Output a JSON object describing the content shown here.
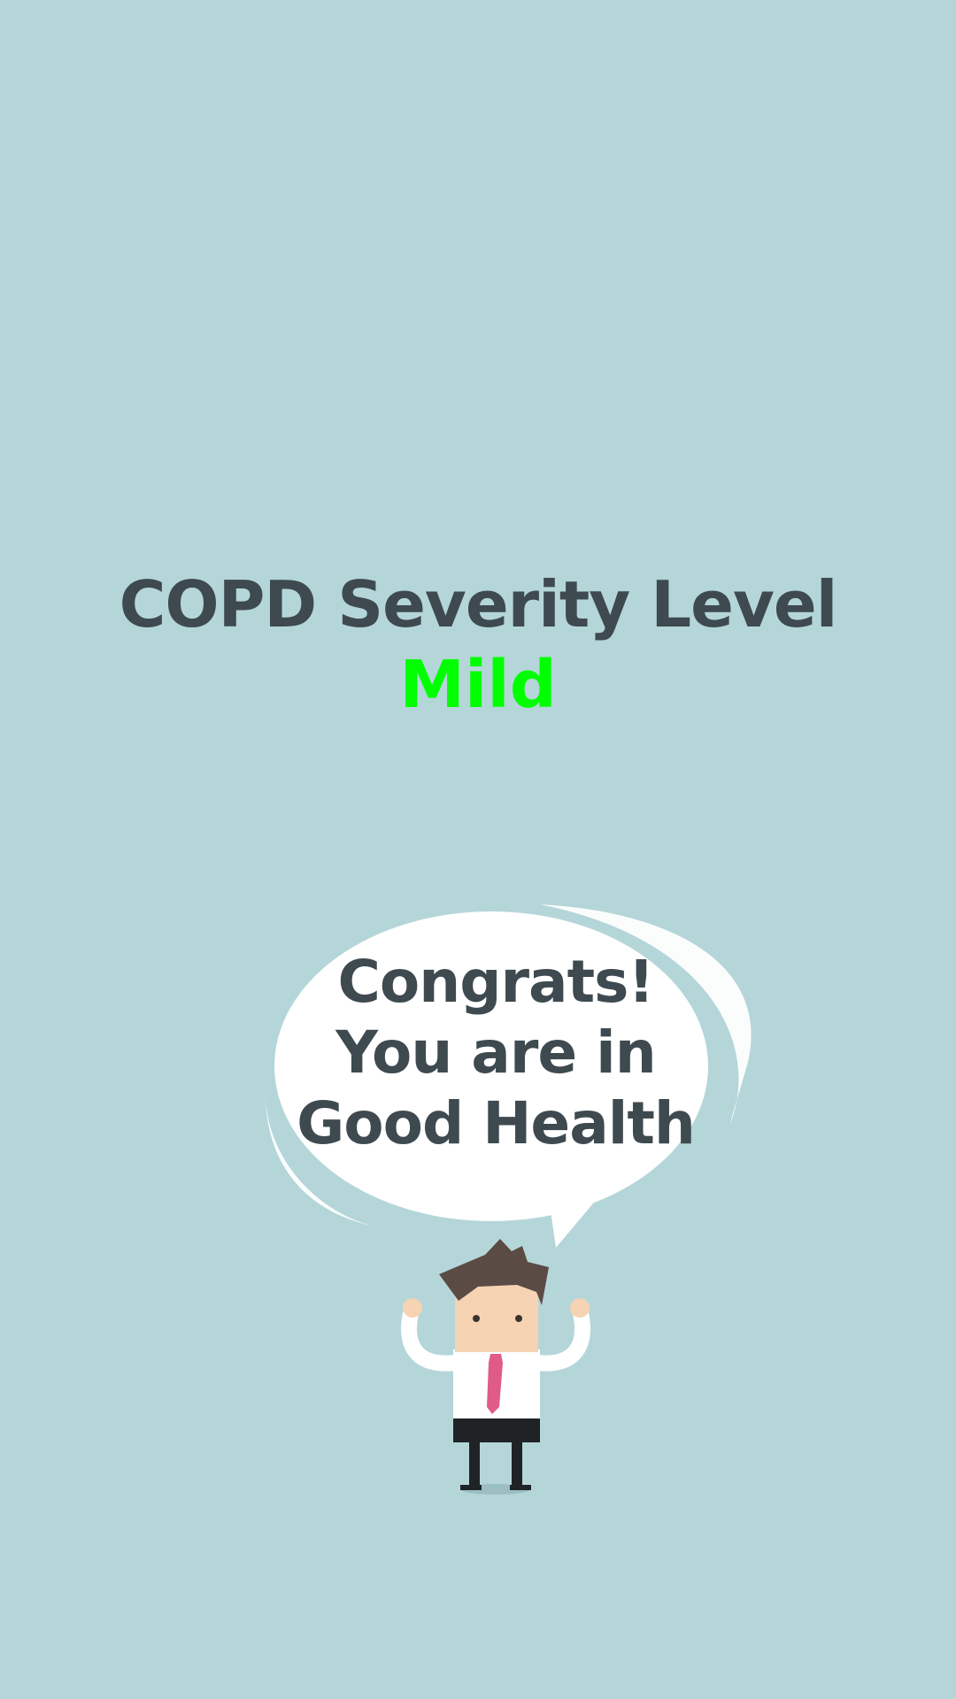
{
  "result": {
    "title": "COPD Severity Level",
    "level": "Mild"
  },
  "bubble": {
    "line1": "Congrats!",
    "line2": "You are in",
    "line3": "Good Health"
  },
  "colors": {
    "background": "#b5d6d9",
    "title_text": "#3e4a4f",
    "level_text": "#00ff00",
    "bubble_fill": "#ffffff",
    "tie": "#e05a8a"
  },
  "illustration": {
    "icon": "happy-businessman-icon"
  }
}
